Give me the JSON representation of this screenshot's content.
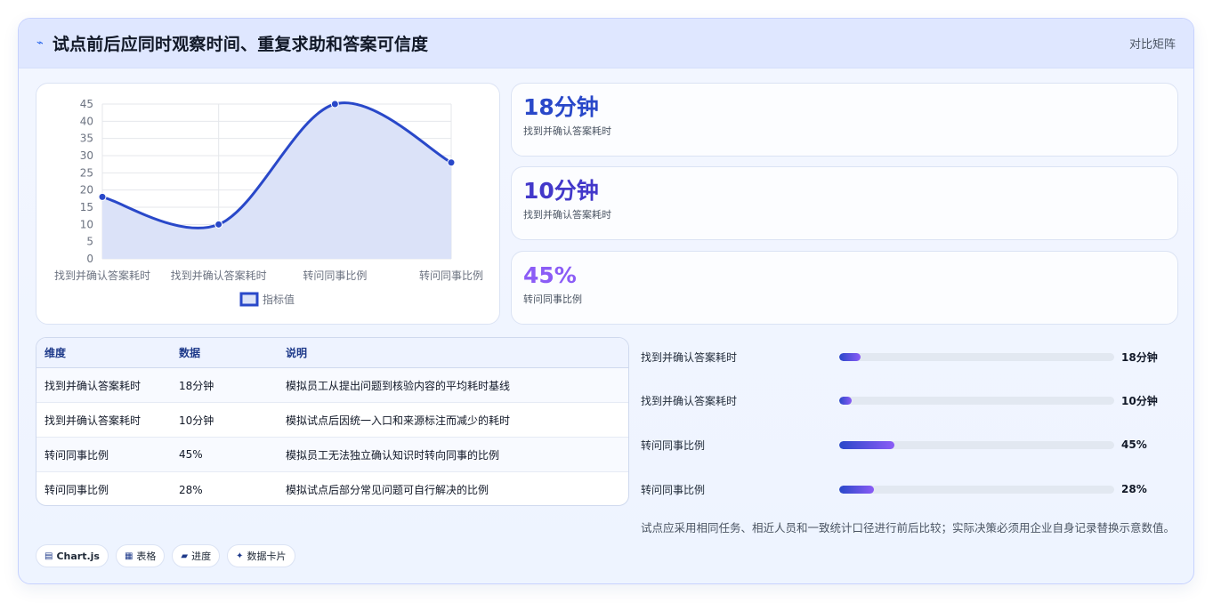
{
  "header": {
    "title": "试点前后应同时观察时间、重复求助和答案可信度",
    "right_link": "对比矩阵",
    "title_icon": "trend-icon"
  },
  "chart_data": {
    "type": "line",
    "categories": [
      "找到并确认答案耗时",
      "找到并确认答案耗时",
      "转问同事比例",
      "转问同事比例"
    ],
    "series": [
      {
        "name": "指标值",
        "values": [
          18,
          10,
          45,
          28
        ]
      }
    ],
    "ylim": [
      0,
      45
    ],
    "yticks": [
      0,
      5,
      10,
      15,
      20,
      25,
      30,
      35,
      40,
      45
    ],
    "legend": "bottom",
    "grid": true,
    "color": "#2948c9",
    "fill": "#dbe2f8"
  },
  "stats": [
    {
      "value": "18分钟",
      "label": "找到并确认答案耗时",
      "color": "#2948c9"
    },
    {
      "value": "10分钟",
      "label": "找到并确认答案耗时",
      "color": "#4338ca"
    },
    {
      "value": "45%",
      "label": "转问同事比例",
      "color": "#8b5cf6"
    }
  ],
  "table": {
    "headers": [
      "维度",
      "数据",
      "说明"
    ],
    "rows": [
      [
        "找到并确认答案耗时",
        "18分钟",
        "模拟员工从提出问题到核验内容的平均耗时基线"
      ],
      [
        "找到并确认答案耗时",
        "10分钟",
        "模拟试点后因统一入口和来源标注而减少的耗时"
      ],
      [
        "转问同事比例",
        "45%",
        "模拟员工无法独立确认知识时转向同事的比例"
      ],
      [
        "转问同事比例",
        "28%",
        "模拟试点后部分常见问题可自行解决的比例"
      ]
    ]
  },
  "progress": [
    {
      "label": "找到并确认答案耗时",
      "value": "18分钟",
      "fraction": 0.078
    },
    {
      "label": "找到并确认答案耗时",
      "value": "10分钟",
      "fraction": 0.045
    },
    {
      "label": "转问同事比例",
      "value": "45%",
      "fraction": 0.2
    },
    {
      "label": "转问同事比例",
      "value": "28%",
      "fraction": 0.125
    }
  ],
  "note": "试点应采用相同任务、相近人员和一致统计口径进行前后比较；实际决策必须用企业自身记录替换示意数值。",
  "tags": [
    {
      "icon": "chart-icon",
      "label": "Chart.js"
    },
    {
      "icon": "table-icon",
      "label": "表格"
    },
    {
      "icon": "progress-icon",
      "label": "进度"
    },
    {
      "icon": "sparkle-icon",
      "label": "数据卡片"
    }
  ]
}
